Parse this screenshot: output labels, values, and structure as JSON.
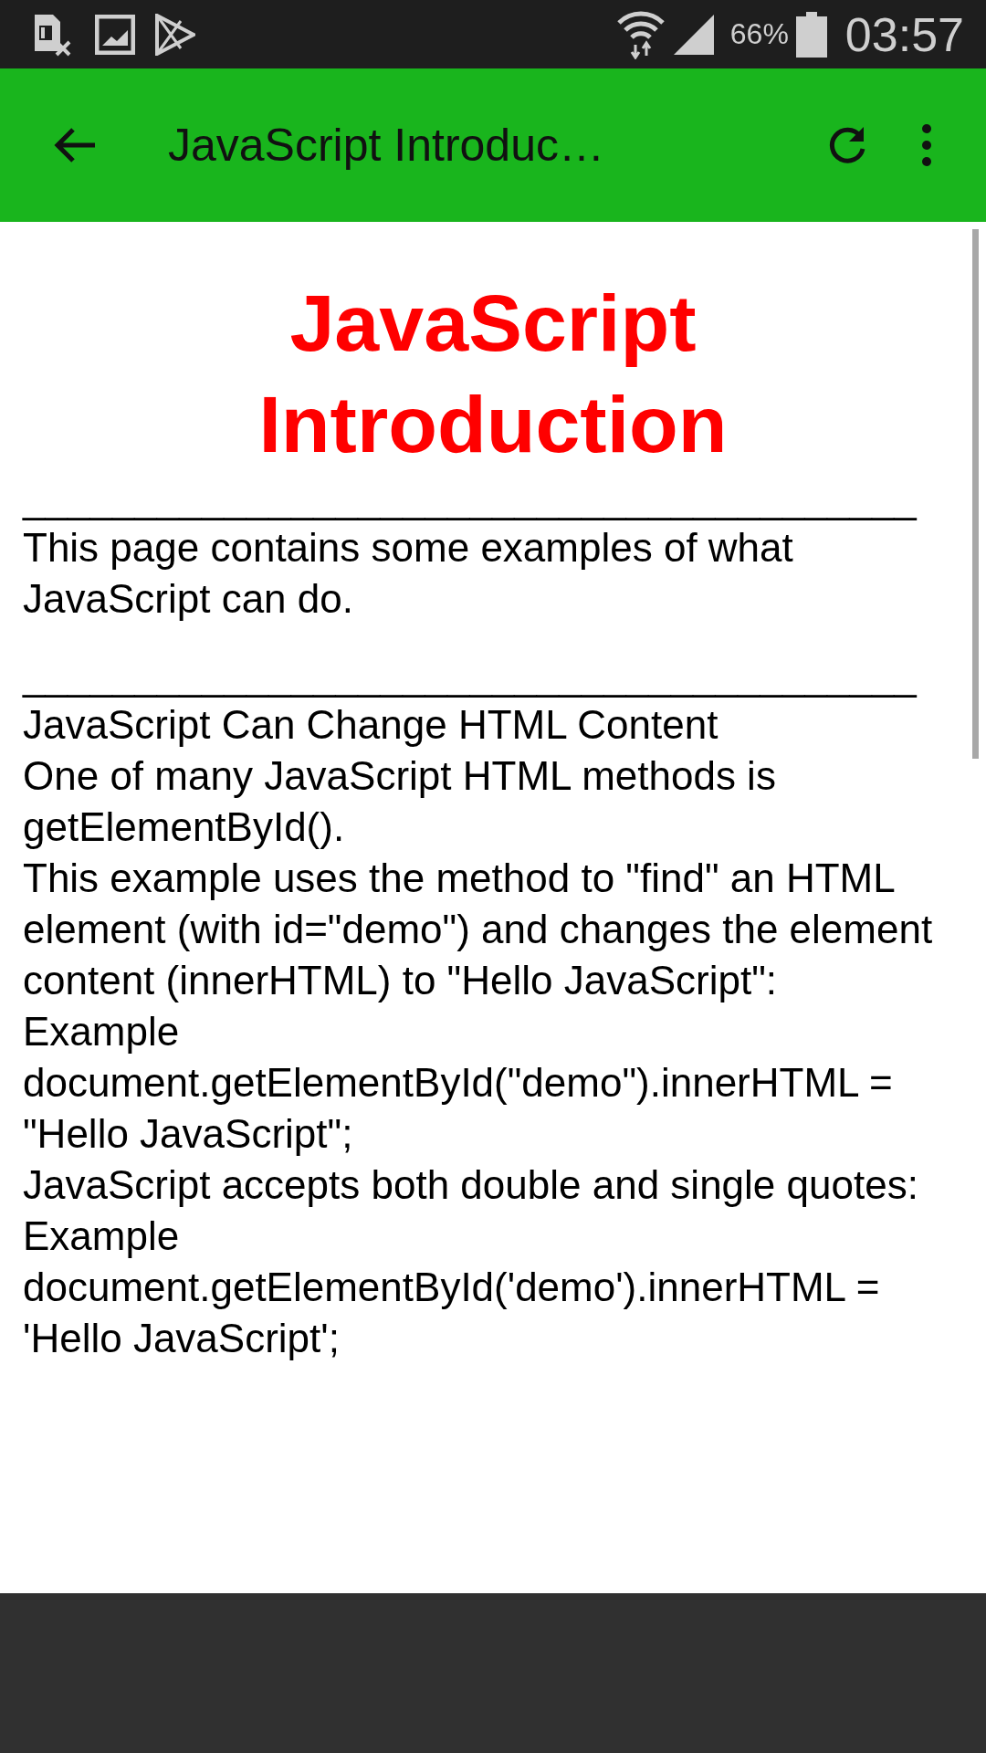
{
  "status_bar": {
    "battery_text": "66%",
    "time": "03:57"
  },
  "app_bar": {
    "title": "JavaScript Introduc…"
  },
  "page": {
    "heading": "JavaScript Introduction",
    "blocks": [
      {
        "kind": "rule",
        "text": "________________________________________"
      },
      {
        "kind": "text",
        "text": "This page contains some examples of what JavaScript can do."
      },
      {
        "kind": "rule",
        "text": "________________________________________"
      },
      {
        "kind": "text",
        "text": "JavaScript Can Change HTML Content"
      },
      {
        "kind": "text",
        "text": "One of many JavaScript HTML methods is getElementById()."
      },
      {
        "kind": "text",
        "text": "This example uses the method to \"find\" an HTML element (with id=\"demo\") and changes the element content (innerHTML) to \"Hello JavaScript\":"
      },
      {
        "kind": "text",
        "text": "Example"
      },
      {
        "kind": "text",
        "text": "document.getElementById(\"demo\").innerHTML = \"Hello JavaScript\";"
      },
      {
        "kind": "text",
        "text": "JavaScript accepts both double and single quotes:"
      },
      {
        "kind": "text",
        "text": "Example"
      },
      {
        "kind": "text",
        "text": "document.getElementById('demo').innerHTML = 'Hello JavaScript';"
      }
    ]
  }
}
